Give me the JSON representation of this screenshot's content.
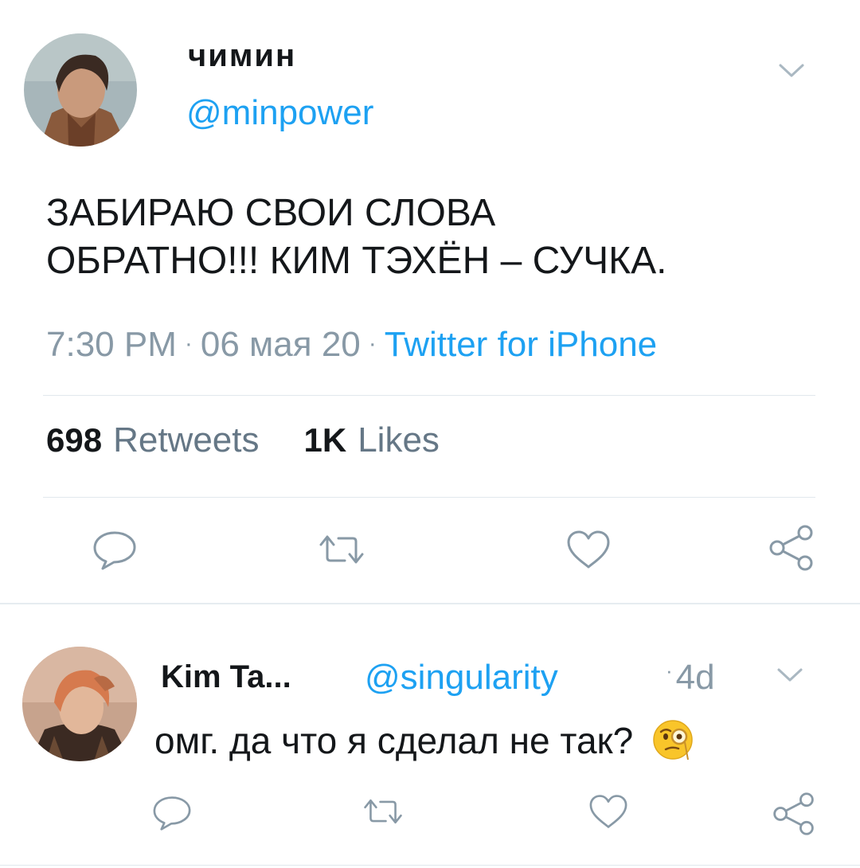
{
  "tweet": {
    "author_name": "чимин",
    "author_handle": "@minpower",
    "text_line1": "ЗАБИРАЮ СВОИ СЛОВА",
    "text_line2": "ОБРАТНО!!! КИМ ТЭХЁН – СУЧКА.",
    "time": "7:30 PM",
    "date": "06 мая 20",
    "source": "Twitter for iPhone",
    "meta_sep": "·",
    "retweets_count": "698",
    "retweets_label": "Retweets",
    "likes_count": "1K",
    "likes_label": "Likes"
  },
  "reply": {
    "author_name": "Kim Ta...",
    "author_handle": "@singularity",
    "time_sep": "·",
    "time": "4d",
    "text": "омг. да что я сделал не так?",
    "emoji": "face-with-monocle"
  },
  "icons": {
    "reply": "reply-icon",
    "retweet": "retweet-icon",
    "like": "heart-icon",
    "share": "share-icon",
    "menu": "chevron-down-icon"
  },
  "colors": {
    "link": "#1da1f2",
    "secondary": "#8899a6",
    "text": "#14171a",
    "divider": "#e1e8ed"
  }
}
